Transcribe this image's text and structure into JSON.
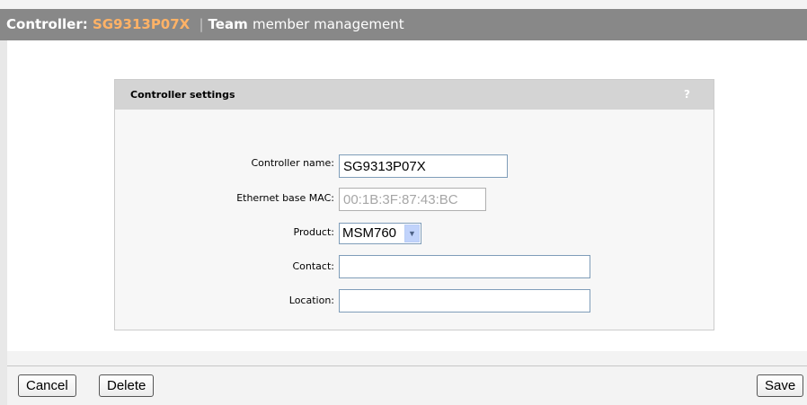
{
  "header": {
    "prefix": "Controller:",
    "controller_name": "SG9313P07X",
    "separator": "|",
    "team": "Team",
    "rest": "member management"
  },
  "panel": {
    "title": "Controller settings",
    "help": "?",
    "fields": {
      "controller_name": {
        "label": "Controller name:",
        "value": "SG9313P07X"
      },
      "ethernet_mac": {
        "label": "Ethernet base MAC:",
        "value": "00:1B:3F:87:43:BC"
      },
      "product": {
        "label": "Product:",
        "value": "MSM760"
      },
      "contact": {
        "label": "Contact:",
        "value": ""
      },
      "location": {
        "label": "Location:",
        "value": ""
      }
    }
  },
  "footer": {
    "cancel_label": "Cancel",
    "delete_label": "Delete",
    "save_label": "Save"
  },
  "colors": {
    "header_bg": "#888888",
    "controller_name_accent": "#ffb266",
    "panel_header_bg": "#d4d4d4"
  }
}
